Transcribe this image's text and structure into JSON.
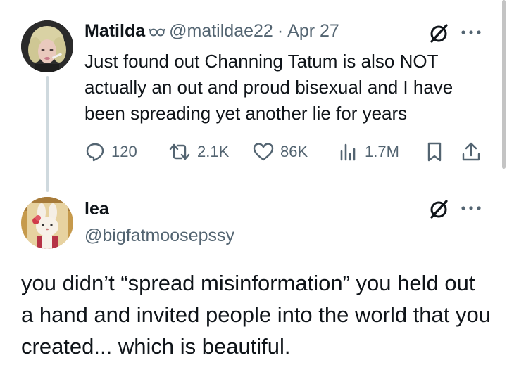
{
  "tweet": {
    "author_name": "Matilda",
    "author_handle": "@matildae22",
    "separator": "·",
    "date": "Apr 27",
    "text": "Just found out Channing Tatum is also NOT actually an out and proud bisexual and I have been spreading yet another lie for years",
    "stats": {
      "replies": "120",
      "reposts": "2.1K",
      "likes": "86K",
      "views": "1.7M"
    },
    "icons": [
      "glasses-icon",
      "grok-icon",
      "more-icon",
      "reply-icon",
      "repost-icon",
      "like-icon",
      "views-icon",
      "bookmark-icon",
      "share-icon"
    ]
  },
  "reply": {
    "author_name": "lea",
    "author_handle": "@bigfatmoosepssy",
    "text": "you didn’t “spread misinformation” you held out a hand and invited people into the world that you created... which is beautiful.",
    "icons": [
      "grok-icon",
      "more-icon"
    ]
  },
  "colors": {
    "text": "#0f1419",
    "secondary": "#536471",
    "thread_line": "#cfd9de"
  }
}
